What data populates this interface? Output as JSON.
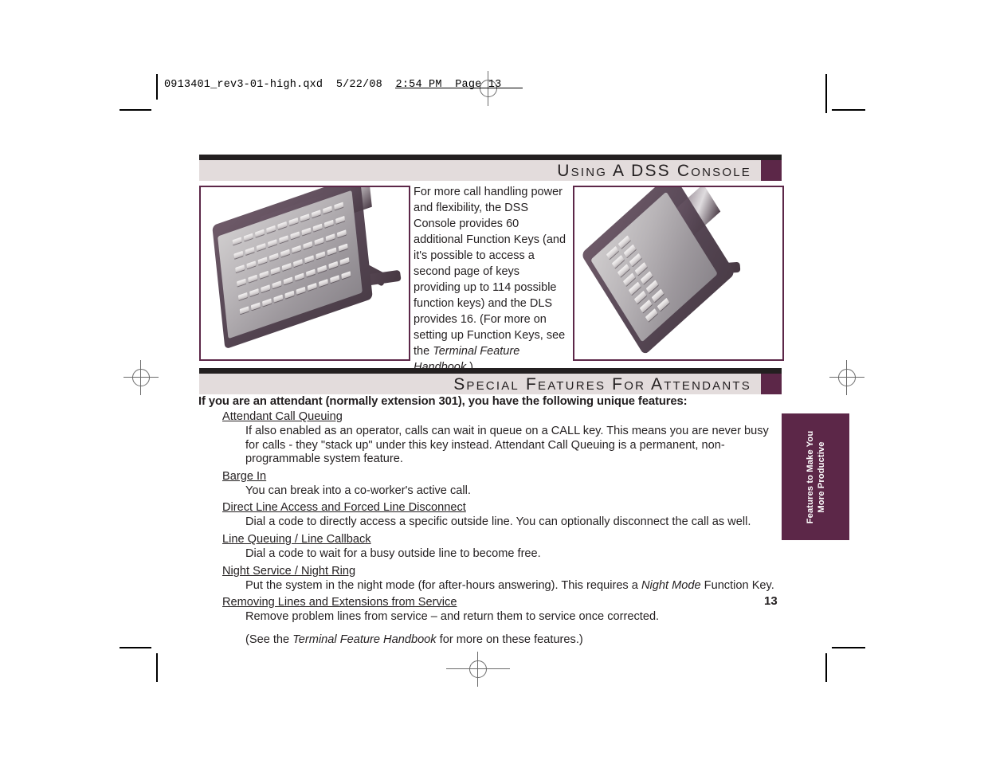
{
  "prepress": {
    "header_text": "0913401_rev3-01-high.qxd  5/22/08  2:54 PM  Page 13"
  },
  "sections": [
    {
      "id": "dss",
      "title": "Using A DSS Console"
    },
    {
      "id": "attendants",
      "title": "Special Features For Attendants"
    }
  ],
  "photos": {
    "left": {
      "caption": "DSS Console 60-key unit"
    },
    "right": {
      "caption": "DLS 16-key unit"
    }
  },
  "intro": {
    "part1": "For more call handling power and flexibility, the DSS Console provides 60 additional Function Keys (and it's possible to access a second page of keys providing up to 114 possible function keys) and the DLS provides 16. (For more on setting up Function Keys, see the ",
    "italic": "Terminal Feature Handbook",
    "part2": ".)"
  },
  "lead": "If you are an attendant (normally extension 301), you have the following unique features:",
  "features": [
    {
      "title": "Attendant Call Queuing",
      "desc": "If also enabled as an operator, calls can wait in queue on a CALL key. This means you are never busy for calls - they \"stack up\" under this key instead. Attendant Call Queuing is a permanent, non-programmable system feature."
    },
    {
      "title": "Barge In",
      "desc": "You can break into a co-worker's active call."
    },
    {
      "title": "Direct Line Access and Forced Line Disconnect",
      "desc": "Dial a code to directly access a specific outside line. You can optionally disconnect the call as well."
    },
    {
      "title": "Line Queuing / Line Callback",
      "desc": "Dial a code to wait for a busy outside line to become free."
    },
    {
      "title": "Night Service / Night Ring",
      "desc_pre": "Put the system in the night mode (for after-hours answering). This requires a ",
      "desc_italic": "Night Mode",
      "desc_post": " Function Key."
    },
    {
      "title": "Removing Lines and Extensions from Service",
      "desc": "Remove problem lines from service – and return them to service once corrected."
    }
  ],
  "note": {
    "pre": "(See the ",
    "italic": "Terminal Feature Handbook",
    "post": " for more on these features.)"
  },
  "side_tab": {
    "line1": "Features to Make You",
    "line2": "More Productive"
  },
  "page_number": "13",
  "colors": {
    "accent_maroon": "#5c2748",
    "bar_background": "#e3dcdc",
    "ink": "#231f20"
  }
}
